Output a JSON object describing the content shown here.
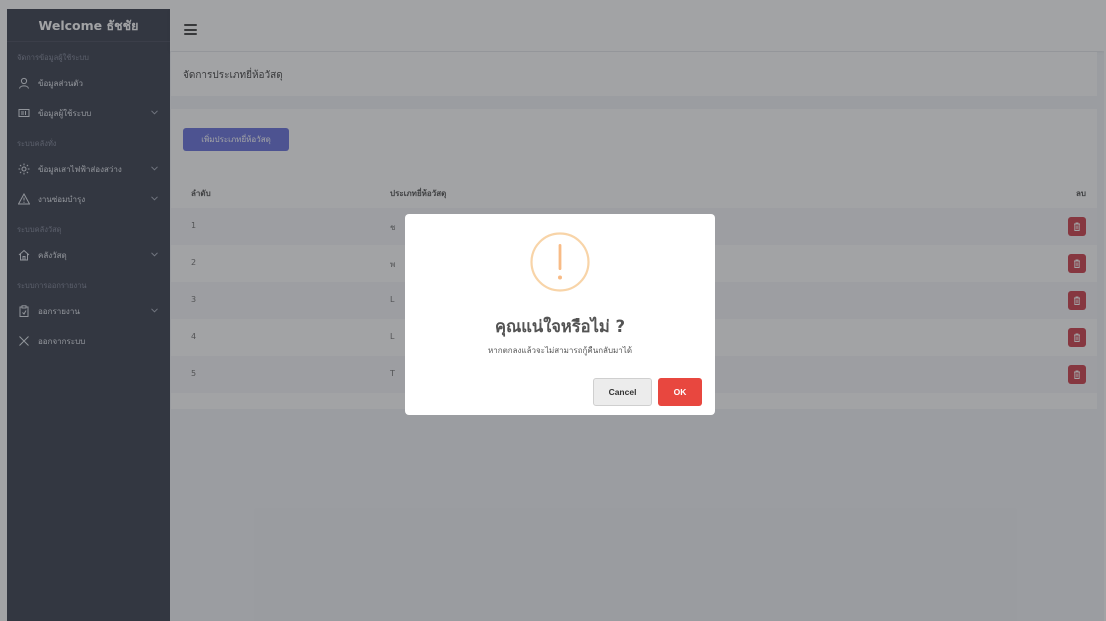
{
  "sidebar": {
    "welcome": "Welcome ธัชชัย",
    "section_user": "จัดการข้อมูลผู้ใช้ระบบ",
    "item_profile": "ข้อมูลส่วนตัว",
    "item_users": "ข้อมูลผู้ใช้ระบบ",
    "section_lamp": "ระบบคลังทั่ง",
    "item_lamp": "ข้อมูลเสาไฟฟ้าส่องสว่าง",
    "item_repair": "งานซ่อมบำรุง",
    "section_stock": "ระบบคลังวัสดุ",
    "item_stock": "คลังวัสดุ",
    "section_report": "ระบบการออกรายงาน",
    "item_report": "ออกรายงาน",
    "item_logout": "ออกจากระบบ",
    "icons": {
      "profile": "user-icon",
      "users": "id-card-icon",
      "lamp": "sun-icon",
      "repair": "warning-triangle-icon",
      "stock": "home-icon",
      "report": "clipboard-icon",
      "logout": "close-icon"
    }
  },
  "topbar": {
    "menu_icon": "hamburger-icon"
  },
  "page": {
    "title": "จัดการประเภทยี่ห้อวัสดุ",
    "add_button": "เพิ่มประเภทยี่ห้อวัสดุ"
  },
  "table": {
    "headers": {
      "no": "ลำดับ",
      "name": "ประเภทยี่ห้อวัสดุ",
      "delete": "ลบ"
    },
    "rows": [
      {
        "no": "1",
        "name": "ช"
      },
      {
        "no": "2",
        "name": "พ"
      },
      {
        "no": "3",
        "name": "L"
      },
      {
        "no": "4",
        "name": "L"
      },
      {
        "no": "5",
        "name": "T"
      }
    ]
  },
  "dialog": {
    "title": "คุณแน่ใจหรือไม่ ?",
    "text": "หากตกลงแล้วจะไม่สามารถกู้คืนกลับมาได้",
    "cancel": "Cancel",
    "ok": "OK",
    "icon": "warning-icon"
  },
  "colors": {
    "sidebar_bg": "#2b3040",
    "primary": "#5d66d8",
    "danger": "#c9303e",
    "ok": "#e8473f",
    "warning": "#f8bb86"
  }
}
